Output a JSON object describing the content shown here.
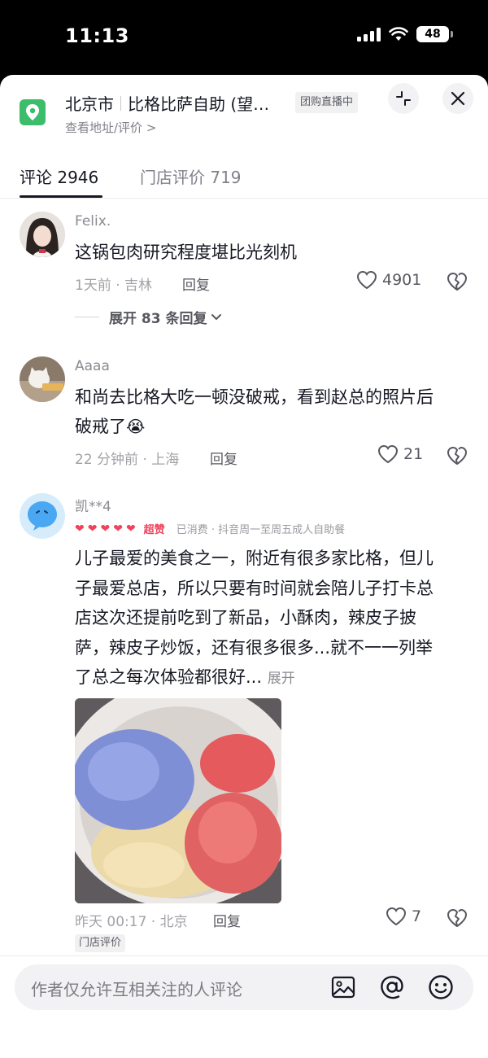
{
  "status_bar": {
    "time": "11:13",
    "battery": "48"
  },
  "header": {
    "city": "北京市",
    "store_name": "比格比萨自助 (望…",
    "live_badge": "团购直播中",
    "subtitle": "查看地址/评价 >"
  },
  "tabs": [
    {
      "label": "评论 2946",
      "active": true
    },
    {
      "label": "门店评价 719",
      "active": false
    }
  ],
  "comments": [
    {
      "user": "Felix.",
      "text": "这锅包肉研究程度堪比光刻机",
      "meta": "1天前 · 吉林",
      "reply_label": "回复",
      "likes": "4901",
      "expand_label": "展开 83 条回复"
    },
    {
      "user": "Aaaa",
      "text_line1": "和尚去比格大吃一顿没破戒，看到赵总的照片后",
      "text_line2": "破戒了",
      "emoji": "😭",
      "meta": "22 分钟前 · 上海",
      "reply_label": "回复",
      "likes": "21"
    },
    {
      "user": "凯**4",
      "rating_hearts": 5,
      "rating_label": "超赞",
      "consumed": "已消费 · 抖音周一至周五成人自助餐",
      "text_lines": [
        "儿子最爱的美食之一，附近有很多家比格，但儿",
        "子最爱总店，所以只要有时间就会陪儿子打卡总",
        "店这次还提前吃到了新品，小酥肉，辣皮子披",
        "萨，辣皮子炒饭，还有很多很多...就不一一列举",
        "了总之每次体验都很好..."
      ],
      "expand_inline": "展开",
      "meta": "昨天 00:17 · 北京",
      "reply_label": "回复",
      "likes": "7",
      "tag": "门店评价"
    }
  ],
  "input": {
    "placeholder": "作者仅允许互相关注的人评论"
  },
  "colors": {
    "accent": "#3dbd6b",
    "heart": "#f2415b",
    "text": "#161823",
    "muted": "#80828a"
  }
}
